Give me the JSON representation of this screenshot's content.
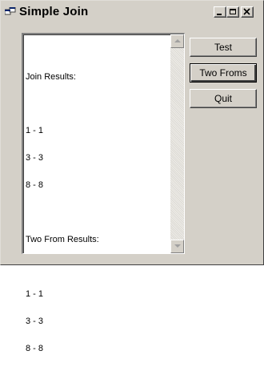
{
  "window": {
    "title": "Simple Join"
  },
  "listbox": {
    "lines": [
      "Join Results:",
      "",
      "1 - 1",
      "3 - 3",
      "8 - 8",
      "",
      "Two From Results:",
      "",
      "1 - 1",
      "3 - 3",
      "8 - 8"
    ]
  },
  "buttons": {
    "test_label": "Test",
    "two_froms_label": "Two Froms",
    "quit_label": "Quit"
  },
  "icons": {
    "app": "app-window-icon",
    "minimize": "minimize-icon",
    "maximize": "maximize-icon",
    "close": "close-icon",
    "scroll_up": "scroll-up-arrow-icon",
    "scroll_down": "scroll-down-arrow-icon"
  }
}
